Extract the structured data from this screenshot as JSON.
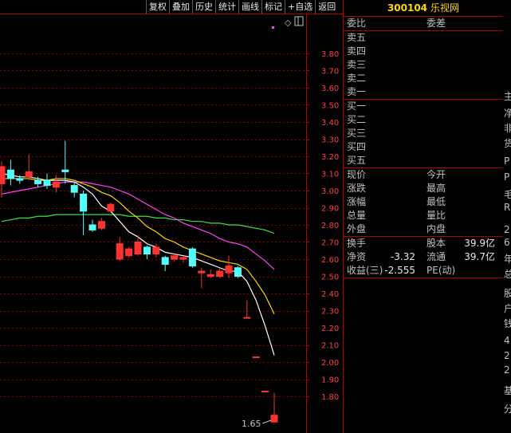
{
  "toolbar": [
    "复权",
    "叠加",
    "历史",
    "统计",
    "画线",
    "标记",
    "+自选",
    "返回"
  ],
  "stock": {
    "code": "300104",
    "name": "乐视网"
  },
  "price_axis": [
    "3.80",
    "3.70",
    "3.60",
    "3.50",
    "3.40",
    "3.30",
    "3.20",
    "3.10",
    "3.00",
    "2.90",
    "2.80",
    "2.70",
    "2.60",
    "2.50",
    "2.40",
    "2.30",
    "2.20",
    "2.10",
    "2.00",
    "1.90",
    "1.80"
  ],
  "low_marker": "1.65",
  "colors": {
    "up": "#ff3232",
    "down": "#54ffff",
    "ma5": "#ffffff",
    "ma10": "#ffd700",
    "ma20": "#ff40ff",
    "ma30": "#40e040",
    "grid": "#880000"
  },
  "orderbook": {
    "ratio_label": "委比",
    "diff_label": "委差",
    "sell": [
      "卖五",
      "卖四",
      "卖三",
      "卖二",
      "卖一"
    ],
    "buy": [
      "买一",
      "买二",
      "买三",
      "买四",
      "买五"
    ]
  },
  "quote": [
    {
      "l": "现价",
      "r": "今开"
    },
    {
      "l": "涨跌",
      "r": "最高"
    },
    {
      "l": "涨幅",
      "r": "最低"
    },
    {
      "l": "总量",
      "r": "量比"
    },
    {
      "l": "外盘",
      "r": "内盘"
    }
  ],
  "fin": [
    {
      "l": "换手",
      "v": "",
      "r": "股本",
      "rv": "39.9亿"
    },
    {
      "l": "净资",
      "v": "-3.32",
      "r": "流通",
      "rv": "39.7亿"
    },
    {
      "l": "收益(三)",
      "v": "-2.555",
      "r": "PE(动)",
      "rv": ""
    }
  ],
  "far_right": [
    "主",
    "净",
    "非",
    "货",
    "P",
    "P",
    "毛",
    "R",
    "2",
    "6",
    "年",
    "总",
    "股",
    "户",
    "钱",
    "4",
    "2",
    "2",
    "基",
    "分"
  ],
  "chart_data": {
    "type": "candlestick",
    "ylim": [
      1.6,
      3.95
    ],
    "candles": [
      {
        "o": 3.04,
        "c": 3.14,
        "h": 3.17,
        "l": 2.96
      },
      {
        "o": 3.12,
        "c": 3.07,
        "h": 3.18,
        "l": 3.03
      },
      {
        "o": 3.07,
        "c": 3.06,
        "h": 3.09,
        "l": 3.04
      },
      {
        "o": 3.08,
        "c": 3.11,
        "h": 3.21,
        "l": 3.06
      },
      {
        "o": 3.06,
        "c": 3.04,
        "h": 3.08,
        "l": 3.02
      },
      {
        "o": 3.06,
        "c": 3.03,
        "h": 3.1,
        "l": 3.01
      },
      {
        "o": 3.02,
        "c": 3.05,
        "h": 3.09,
        "l": 2.99
      },
      {
        "o": 3.12,
        "c": 3.11,
        "h": 3.29,
        "l": 3.04
      },
      {
        "o": 3.03,
        "c": 2.99,
        "h": 3.05,
        "l": 2.96
      },
      {
        "o": 2.98,
        "c": 2.88,
        "h": 3.0,
        "l": 2.74
      },
      {
        "o": 2.8,
        "c": 2.77,
        "h": 2.83,
        "l": 2.76
      },
      {
        "o": 2.78,
        "c": 2.82,
        "h": 2.84,
        "l": 2.77
      },
      {
        "o": 2.88,
        "c": 2.92,
        "h": 2.93,
        "l": 2.87
      },
      {
        "o": 2.6,
        "c": 2.69,
        "h": 2.73,
        "l": 2.59
      },
      {
        "o": 2.62,
        "c": 2.66,
        "h": 2.67,
        "l": 2.61
      },
      {
        "o": 2.63,
        "c": 2.7,
        "h": 2.74,
        "l": 2.62
      },
      {
        "o": 2.67,
        "c": 2.63,
        "h": 2.68,
        "l": 2.6
      },
      {
        "o": 2.63,
        "c": 2.67,
        "h": 2.69,
        "l": 2.61
      },
      {
        "o": 2.61,
        "c": 2.57,
        "h": 2.62,
        "l": 2.53
      },
      {
        "o": 2.6,
        "c": 2.62,
        "h": 2.63,
        "l": 2.59
      },
      {
        "o": 2.6,
        "c": 2.61,
        "h": 2.62,
        "l": 2.58
      },
      {
        "o": 2.66,
        "c": 2.56,
        "h": 2.67,
        "l": 2.55
      },
      {
        "o": 2.52,
        "c": 2.53,
        "h": 2.55,
        "l": 2.43
      },
      {
        "o": 2.5,
        "c": 2.51,
        "h": 2.54,
        "l": 2.49
      },
      {
        "o": 2.5,
        "c": 2.53,
        "h": 2.55,
        "l": 2.49
      },
      {
        "o": 2.52,
        "c": 2.56,
        "h": 2.62,
        "l": 2.49
      },
      {
        "o": 2.55,
        "c": 2.5,
        "h": 2.56,
        "l": 2.49
      },
      {
        "o": 2.26,
        "c": 2.26,
        "h": 2.36,
        "l": 2.26
      },
      {
        "o": 2.03,
        "c": 2.03,
        "h": 2.03,
        "l": 2.03
      },
      {
        "o": 1.83,
        "c": 1.83,
        "h": 1.83,
        "l": 1.83
      },
      {
        "o": 1.65,
        "c": 1.69,
        "h": 1.82,
        "l": 1.65
      }
    ],
    "ma5": [
      3.1,
      3.09,
      3.08,
      3.08,
      3.07,
      3.06,
      3.06,
      3.06,
      3.05,
      3.02,
      2.98,
      2.91,
      2.88,
      2.82,
      2.76,
      2.73,
      2.69,
      2.67,
      2.64,
      2.63,
      2.62,
      2.61,
      2.59,
      2.57,
      2.55,
      2.53,
      2.53,
      2.47,
      2.36,
      2.21,
      2.04
    ],
    "ma10": [
      3.07,
      3.07,
      3.07,
      3.07,
      3.06,
      3.06,
      3.07,
      3.07,
      3.06,
      3.04,
      3.02,
      2.99,
      2.97,
      2.93,
      2.88,
      2.84,
      2.79,
      2.76,
      2.72,
      2.7,
      2.67,
      2.65,
      2.63,
      2.61,
      2.59,
      2.58,
      2.57,
      2.54,
      2.47,
      2.39,
      2.28
    ],
    "ma20": [
      2.98,
      2.99,
      3.0,
      3.01,
      3.02,
      3.03,
      3.04,
      3.05,
      3.05,
      3.05,
      3.04,
      3.03,
      3.02,
      3.0,
      2.98,
      2.95,
      2.92,
      2.89,
      2.86,
      2.84,
      2.81,
      2.79,
      2.77,
      2.75,
      2.72,
      2.7,
      2.69,
      2.67,
      2.63,
      2.59,
      2.54
    ],
    "ma30": [
      2.82,
      2.83,
      2.84,
      2.84,
      2.85,
      2.85,
      2.86,
      2.86,
      2.86,
      2.86,
      2.86,
      2.86,
      2.86,
      2.86,
      2.85,
      2.85,
      2.85,
      2.84,
      2.84,
      2.83,
      2.83,
      2.82,
      2.82,
      2.81,
      2.81,
      2.8,
      2.8,
      2.79,
      2.78,
      2.77,
      2.75
    ]
  }
}
